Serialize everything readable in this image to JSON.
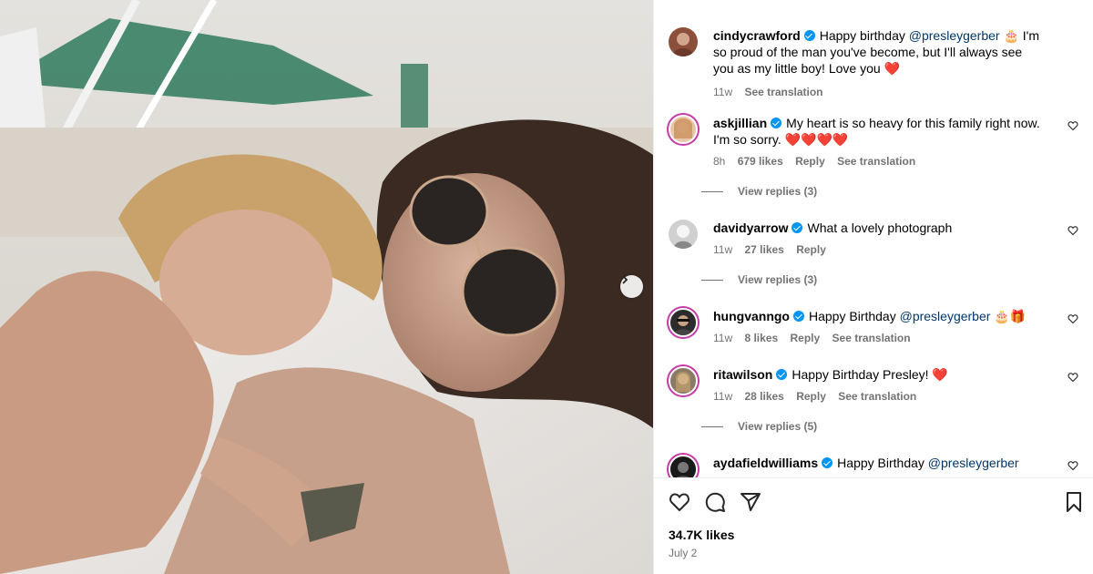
{
  "photo": {
    "description_icon": "carousel-next-icon"
  },
  "comments": [
    {
      "username": "cindycrawford",
      "verified": true,
      "text_before": "Happy birthday ",
      "mention": "@presleygerber",
      "text_after": " 🎂 I'm so proud of the man you've become, but I'll always see you as my little boy! Love you ❤️",
      "time": "11w",
      "likes": "",
      "reply": "",
      "translation": "See translation",
      "is_caption": true
    },
    {
      "username": "askjillian",
      "verified": true,
      "text": "My heart is so heavy for this family right now. I'm so sorry. ❤️❤️❤️❤️",
      "time": "8h",
      "likes": "679 likes",
      "reply": "Reply",
      "translation": "See translation",
      "replies": "View replies (3)"
    },
    {
      "username": "davidyarrow",
      "verified": true,
      "text": "What a lovely photograph",
      "time": "11w",
      "likes": "27 likes",
      "reply": "Reply",
      "replies": "View replies (3)"
    },
    {
      "username": "hungvanngo",
      "verified": true,
      "text_before": "Happy Birthday ",
      "mention": "@presleygerber",
      "text_after": " 🎂🎁",
      "time": "11w",
      "likes": "8 likes",
      "reply": "Reply",
      "translation": "See translation"
    },
    {
      "username": "ritawilson",
      "verified": true,
      "text": "Happy Birthday Presley! ❤️",
      "time": "11w",
      "likes": "28 likes",
      "reply": "Reply",
      "translation": "See translation",
      "replies": "View replies (5)"
    },
    {
      "username": "aydafieldwilliams",
      "verified": true,
      "text_before": "Happy Birthday ",
      "mention": "@presleygerber",
      "text_after": ""
    }
  ],
  "actions": {
    "likes": "34.7K likes",
    "date": "July 2",
    "icons": [
      "heart-icon",
      "comment-icon",
      "share-icon",
      "bookmark-icon"
    ]
  }
}
